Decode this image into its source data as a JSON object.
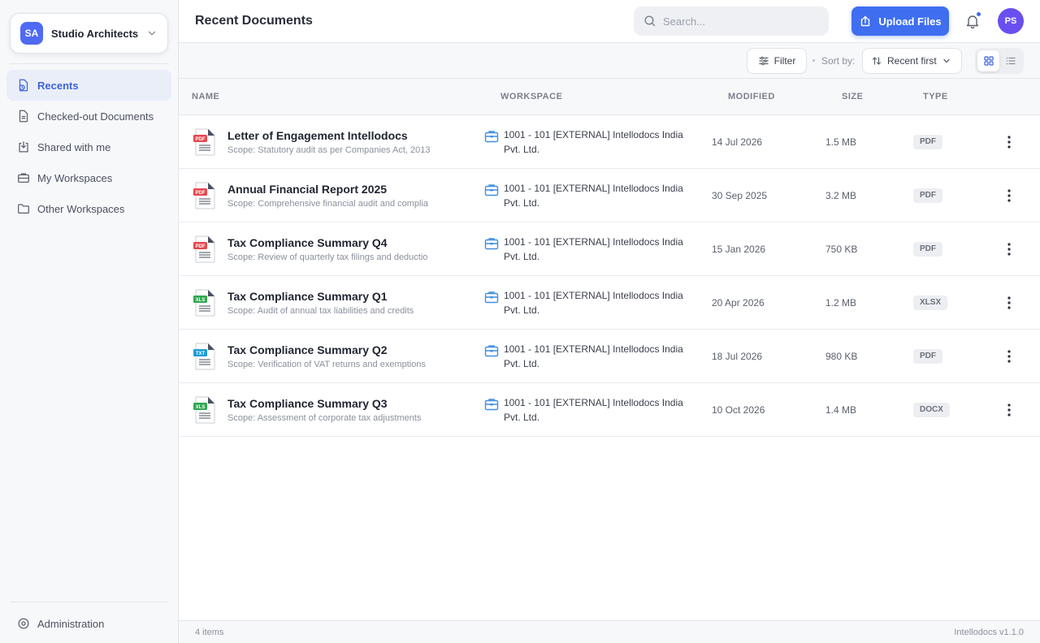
{
  "org": {
    "initials": "SA",
    "name": "Studio Architects"
  },
  "sidebar": {
    "items": [
      {
        "label": "Recents",
        "icon": "recent-file-icon",
        "active": true
      },
      {
        "label": "Checked-out Documents",
        "icon": "checked-out-doc-icon",
        "active": false
      },
      {
        "label": "Shared with me",
        "icon": "shared-inbox-icon",
        "active": false
      },
      {
        "label": "My Workspaces",
        "icon": "briefcase-icon",
        "active": false
      },
      {
        "label": "Other Workspaces",
        "icon": "folder-icon",
        "active": false
      }
    ],
    "admin_label": "Administration"
  },
  "header": {
    "title": "Recent Documents",
    "search_placeholder": "Search...",
    "upload_label": "Upload Files",
    "user_initials": "PS"
  },
  "toolbar": {
    "filter_label": "Filter",
    "sort_label": "Sort by:",
    "sort_value": "Recent first",
    "view_mode": "grid"
  },
  "table": {
    "columns": [
      "NAME",
      "WORKSPACE",
      "MODIFIED",
      "SIZE",
      "TYPE"
    ],
    "rows": [
      {
        "icon_tag": "PDF",
        "title": "Letter of Engagement Intellodocs",
        "scope": "Scope: Statutory audit as per Companies Act, 2013",
        "workspace": "1001 - 101 [EXTERNAL] Intellodocs India Pvt. Ltd.",
        "modified": "14 Jul 2026",
        "size": "1.5 MB",
        "type": "PDF"
      },
      {
        "icon_tag": "PDF",
        "title": "Annual Financial Report 2025",
        "scope": "Scope: Comprehensive financial audit and complia",
        "workspace": "1001 - 101 [EXTERNAL] Intellodocs India Pvt. Ltd.",
        "modified": "30 Sep 2025",
        "size": "3.2 MB",
        "type": "PDF"
      },
      {
        "icon_tag": "PDF",
        "title": "Tax Compliance Summary Q4",
        "scope": "Scope: Review of quarterly tax filings and deductio",
        "workspace": "1001 - 101 [EXTERNAL] Intellodocs India Pvt. Ltd.",
        "modified": "15 Jan 2026",
        "size": "750 KB",
        "type": "PDF"
      },
      {
        "icon_tag": "XLS",
        "title": "Tax Compliance Summary Q1",
        "scope": "Scope: Audit of annual tax liabilities and credits",
        "workspace": "1001 - 101 [EXTERNAL] Intellodocs India Pvt. Ltd.",
        "modified": "20 Apr 2026",
        "size": "1.2 MB",
        "type": "XLSX"
      },
      {
        "icon_tag": "TXT",
        "title": "Tax Compliance Summary Q2",
        "scope": "Scope: Verification of VAT returns and exemptions",
        "workspace": "1001 - 101 [EXTERNAL] Intellodocs India Pvt. Ltd.",
        "modified": "18 Jul 2026",
        "size": "980 KB",
        "type": "PDF"
      },
      {
        "icon_tag": "XLS",
        "title": "Tax Compliance Summary Q3",
        "scope": "Scope: Assessment of corporate tax adjustments",
        "workspace": "1001 - 101 [EXTERNAL] Intellodocs India Pvt. Ltd.",
        "modified": "10 Oct 2026",
        "size": "1.4 MB",
        "type": "DOCX"
      }
    ]
  },
  "footer": {
    "count": "4 items",
    "version": "Intellodocs v1.1.0"
  },
  "colors": {
    "accent": "#3f6ef0",
    "pdf": "#e5484d",
    "xls": "#2fa84f",
    "txt": "#1e9bd7"
  }
}
